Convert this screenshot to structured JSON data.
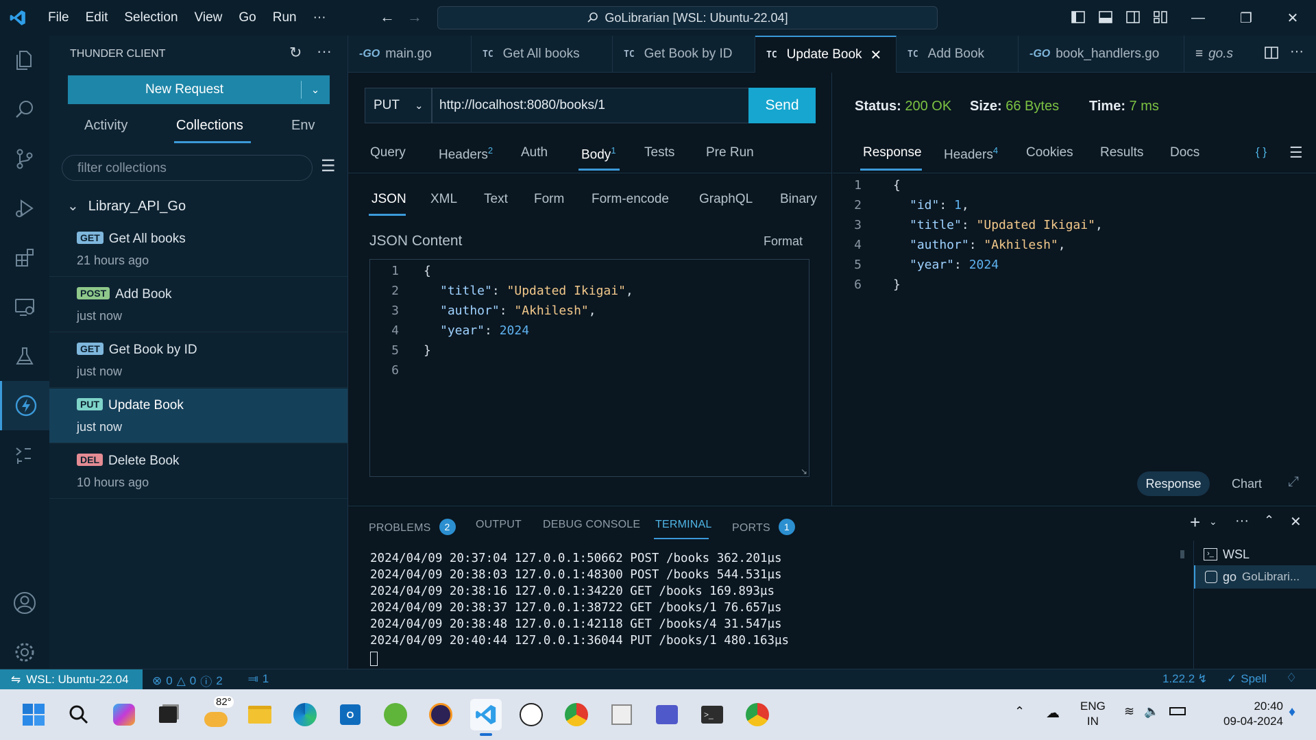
{
  "titlebar": {
    "menu": [
      "File",
      "Edit",
      "Selection",
      "View",
      "Go",
      "Run",
      "···"
    ],
    "search_text": "GoLibrarian [WSL: Ubuntu-22.04]"
  },
  "sidebar": {
    "title": "THUNDER CLIENT",
    "new_request": "New Request",
    "tabs": [
      "Activity",
      "Collections",
      "Env"
    ],
    "filter_placeholder": "filter collections",
    "collection_name": "Library_API_Go",
    "items": [
      {
        "method": "GET",
        "name": "Get All books",
        "time": "21 hours ago"
      },
      {
        "method": "POST",
        "name": "Add Book",
        "time": "just now"
      },
      {
        "method": "GET",
        "name": "Get Book by ID",
        "time": "just now"
      },
      {
        "method": "PUT",
        "name": "Update Book",
        "time": "just now"
      },
      {
        "method": "DEL",
        "name": "Delete Book",
        "time": "10 hours ago"
      }
    ]
  },
  "tabs": [
    {
      "icon": "GO",
      "label": "main.go"
    },
    {
      "icon": "TC",
      "label": "Get All books"
    },
    {
      "icon": "TC",
      "label": "Get Book by ID"
    },
    {
      "icon": "TC",
      "label": "Update Book"
    },
    {
      "icon": "TC",
      "label": "Add Book"
    },
    {
      "icon": "GO",
      "label": "book_handlers.go"
    },
    {
      "icon": "≡",
      "label": "go.s"
    }
  ],
  "request": {
    "method": "PUT",
    "url": "http://localhost:8080/books/1",
    "send": "Send",
    "tabs": {
      "query": "Query",
      "headers": "Headers",
      "headers_count": "2",
      "auth": "Auth",
      "body": "Body",
      "body_count": "1",
      "tests": "Tests",
      "prerun": "Pre Run"
    },
    "body_types": [
      "JSON",
      "XML",
      "Text",
      "Form",
      "Form-encode",
      "GraphQL",
      "Binary"
    ],
    "json_label": "JSON Content",
    "format": "Format",
    "line_numbers": [
      "1",
      "2",
      "3",
      "4",
      "5",
      "6"
    ],
    "json": {
      "open": "{",
      "title_key": "\"title\"",
      "title_val": "\"Updated Ikigai\"",
      "author_key": "\"author\"",
      "author_val": "\"Akhilesh\"",
      "year_key": "\"year\"",
      "year_val": "2024",
      "close": "}"
    }
  },
  "response": {
    "status_label": "Status:",
    "status": "200 OK",
    "size_label": "Size:",
    "size": "66 Bytes",
    "time_label": "Time:",
    "time": "7 ms",
    "tabs": {
      "response": "Response",
      "headers": "Headers",
      "headers_count": "4",
      "cookies": "Cookies",
      "results": "Results",
      "docs": "Docs"
    },
    "braces": "{ }",
    "line_numbers": [
      "1",
      "2",
      "3",
      "4",
      "5",
      "6"
    ],
    "json": {
      "open": "{",
      "id_key": "\"id\"",
      "id_val": "1",
      "title_key": "\"title\"",
      "title_val": "\"Updated Ikigai\"",
      "author_key": "\"author\"",
      "author_val": "\"Akhilesh\"",
      "year_key": "\"year\"",
      "year_val": "2024",
      "close": "}"
    },
    "view_response": "Response",
    "view_chart": "Chart"
  },
  "panel": {
    "tabs": {
      "problems": "PROBLEMS",
      "problems_count": "2",
      "output": "OUTPUT",
      "debug": "DEBUG CONSOLE",
      "terminal": "TERMINAL",
      "ports": "PORTS",
      "ports_count": "1"
    },
    "terminal_lines": [
      "2024/04/09 20:37:04 127.0.0.1:50662 POST /books 362.201µs",
      "2024/04/09 20:38:03 127.0.0.1:48300 POST /books 544.531µs",
      "2024/04/09 20:38:16 127.0.0.1:34220 GET /books 169.893µs",
      "2024/04/09 20:38:37 127.0.0.1:38722 GET /books/1 76.657µs",
      "2024/04/09 20:38:48 127.0.0.1:42118 GET /books/4 31.547µs",
      "2024/04/09 20:40:44 127.0.0.1:36044 PUT /books/1 480.163µs"
    ],
    "terminals": [
      {
        "icon": "terminal-icon",
        "label": "WSL",
        "sub": ""
      },
      {
        "icon": "go-terminal-icon",
        "label": "go",
        "sub": "GoLibrari..."
      }
    ]
  },
  "statusbar": {
    "remote": "WSL: Ubuntu-22.04",
    "errors": "0",
    "warnings": "0",
    "info": "2",
    "ports": "1",
    "go_version": "1.22.2",
    "spell": "Spell"
  },
  "taskbar": {
    "weather": "82°",
    "lang1": "ENG",
    "lang2": "IN",
    "time": "20:40",
    "date": "09-04-2024"
  }
}
